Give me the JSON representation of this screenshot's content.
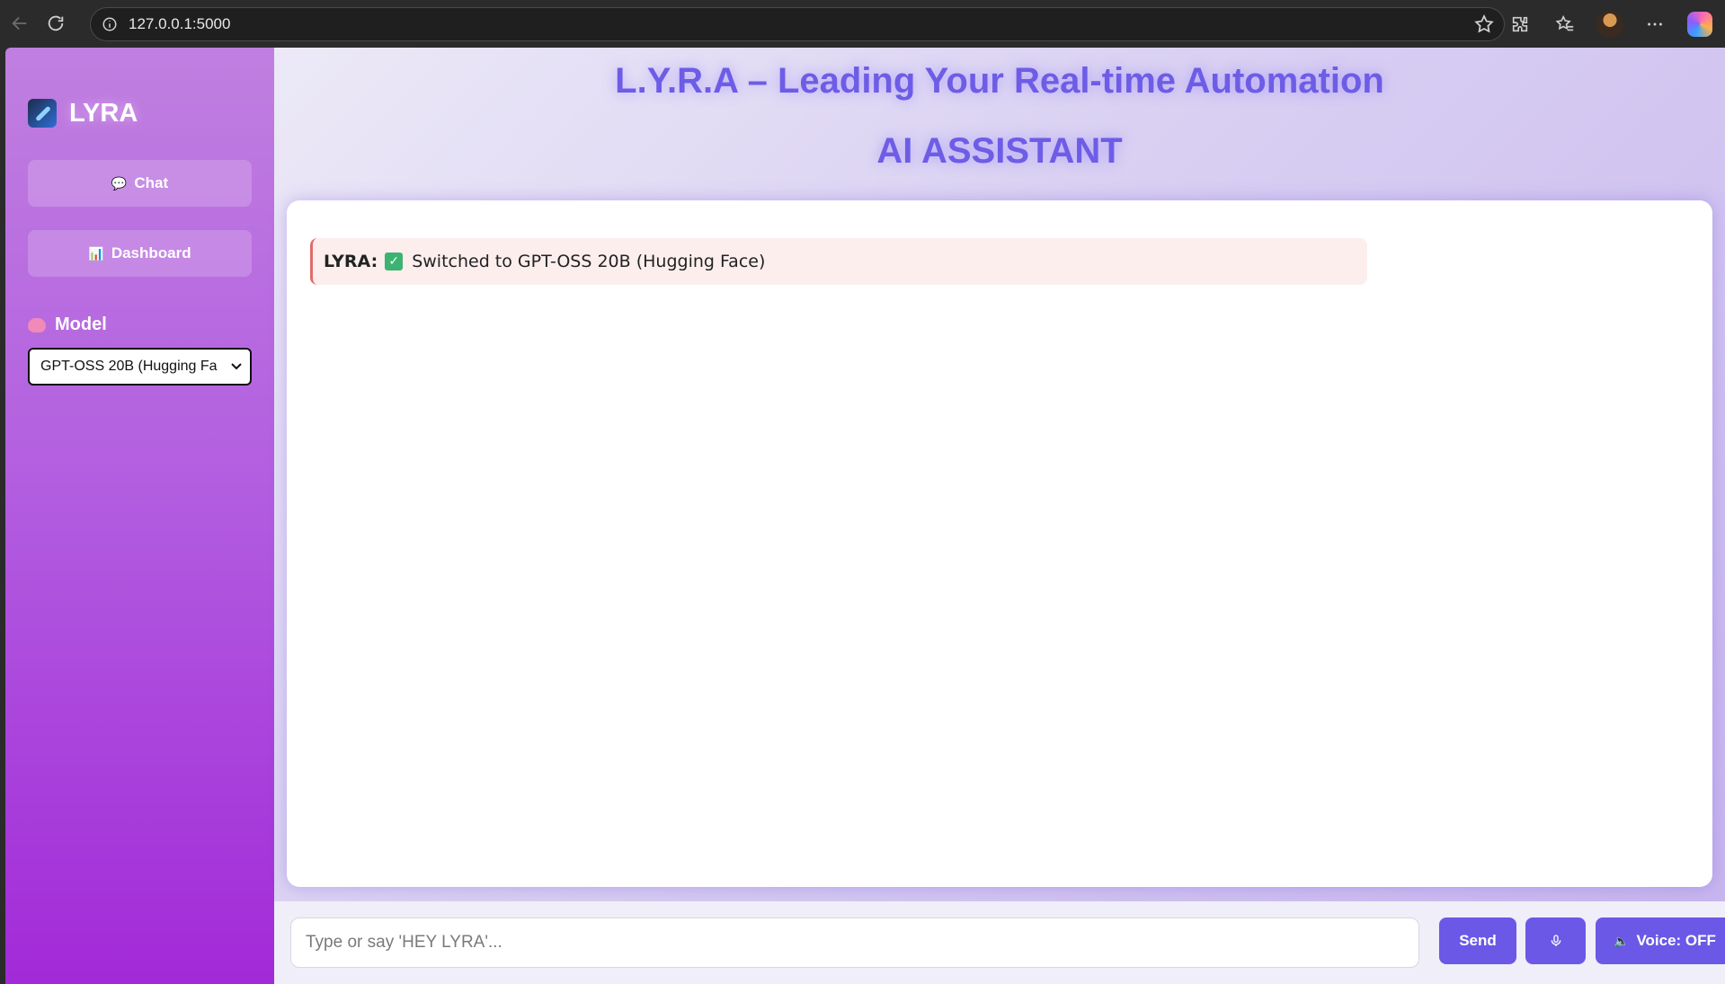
{
  "browser": {
    "url": "127.0.0.1:5000"
  },
  "sidebar": {
    "logo_text": "LYRA",
    "chat_label": "Chat",
    "dashboard_label": "Dashboard",
    "model_label": "Model",
    "model_selected": "GPT-OSS 20B (Hugging Fa"
  },
  "main": {
    "title": "L.Y.R.A – Leading Your Real-time Automation",
    "subtitle": "AI ASSISTANT",
    "messages": [
      {
        "sender": "LYRA:",
        "text": "Switched to GPT-OSS 20B (Hugging Face)"
      }
    ]
  },
  "input_bar": {
    "placeholder": "Type or say 'HEY LYRA'...",
    "send_label": "Send",
    "voice_label": "Voice: OFF"
  }
}
